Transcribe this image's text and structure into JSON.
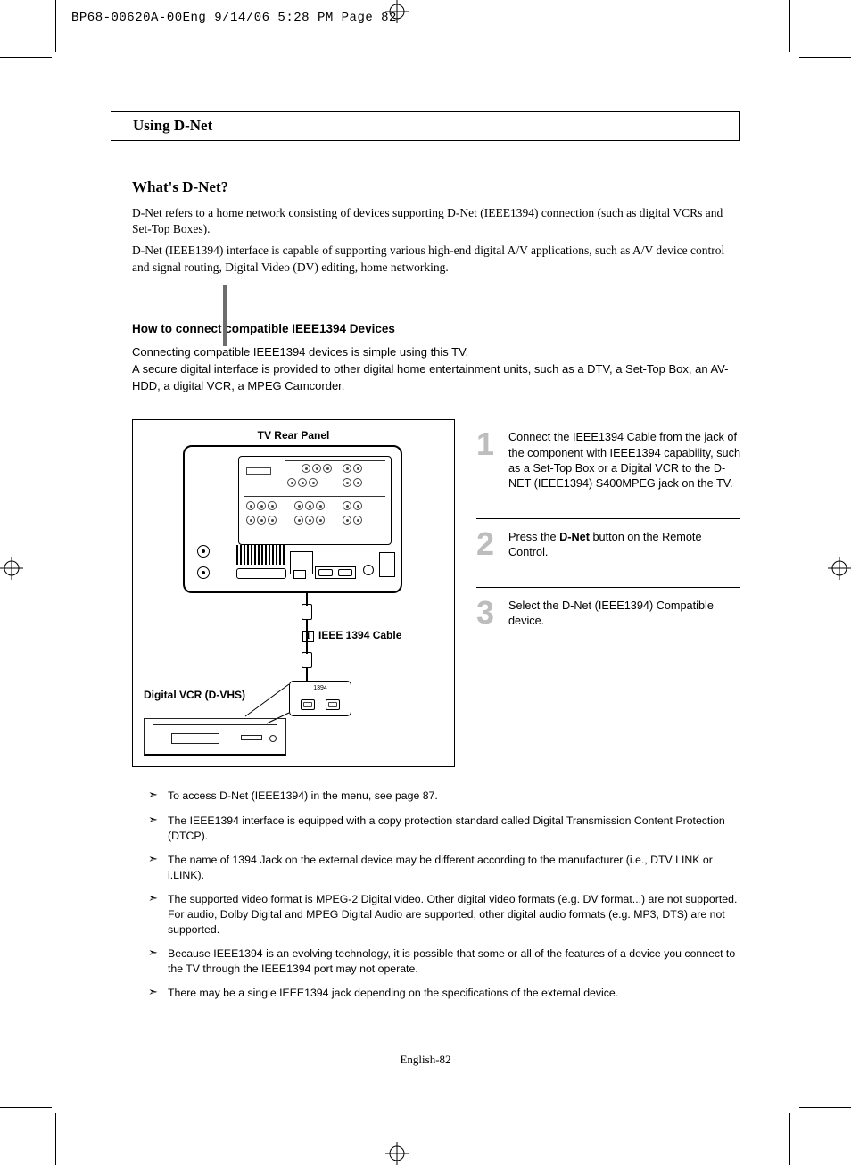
{
  "header_line": "BP68-00620A-00Eng  9/14/06  5:28 PM  Page 82",
  "page_title": "Using D-Net",
  "whats_dnet": {
    "heading": "What's D-Net?",
    "p1": "D-Net refers to a home network consisting of devices supporting D-Net (IEEE1394) connection (such as digital VCRs and Set-Top Boxes).",
    "p2": "D-Net (IEEE1394) interface is capable of supporting various high-end digital A/V applications, such as A/V device control and signal routing, Digital Video (DV) editing, home networking."
  },
  "how_to": {
    "heading": "How to connect compatible IEEE1394 Devices",
    "p1": "Connecting compatible IEEE1394 devices is simple using this TV.",
    "p2": "A secure digital interface is provided to other digital home entertainment units, such as a DTV, a Set-Top Box, an AV-HDD, a digital VCR, a MPEG Camcorder."
  },
  "diagram": {
    "title": "TV Rear Panel",
    "cable_num": "1",
    "cable_label": "IEEE 1394 Cable",
    "vcr_label": "Digital VCR (D-VHS)",
    "vcr_port_label": "1394"
  },
  "steps": [
    {
      "num": "1",
      "text_a": "Connect the IEEE1394 Cable from the jack of the component with IEEE1394 capability, such as a Set-Top Box or a Digital VCR to the D-NET (IEEE1394) S400MPEG jack on the TV."
    },
    {
      "num": "2",
      "text_a": "Press the ",
      "bold": "D-Net",
      "text_b": " button on the Remote Control."
    },
    {
      "num": "3",
      "text_a": "Select the D-Net (IEEE1394) Compatible device."
    }
  ],
  "notes": [
    "To access D-Net (IEEE1394) in the menu, see page 87.",
    "The IEEE1394 interface is equipped with a copy protection standard called Digital Transmission Content Protection (DTCP).",
    "The name of 1394 Jack on the external device may be different according to the manufacturer (i.e., DTV LINK or i.LINK).",
    "The supported video format is MPEG-2 Digital video. Other digital video formats (e.g. DV format...) are not supported. For audio, Dolby Digital and MPEG Digital Audio are supported, other digital audio formats (e.g. MP3, DTS) are not supported.",
    "Because IEEE1394 is an evolving technology, it is possible that some or all of the features of a device you connect to the TV through the IEEE1394 port may not operate.",
    "There may be a single IEEE1394 jack depending on the specifications of the external device."
  ],
  "footer": "English-82"
}
